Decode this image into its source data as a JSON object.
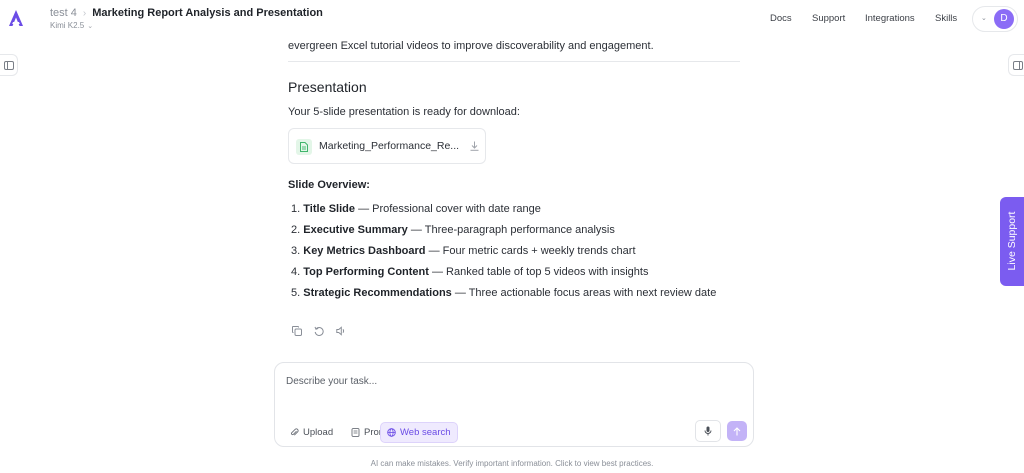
{
  "header": {
    "project": "test 4",
    "separator": "›",
    "title": "Marketing Report Analysis and Presentation",
    "model": "Kimi K2.5",
    "nav": {
      "docs": "Docs",
      "support": "Support",
      "integrations": "Integrations",
      "skills": "Skills"
    },
    "avatar_initial": "D"
  },
  "message": {
    "previous_text": "evergreen Excel tutorial videos to improve discoverability and engagement.",
    "section_title": "Presentation",
    "ready_text": "Your 5-slide presentation is ready for download:",
    "file_name": "Marketing_Performance_Re...",
    "overview_title": "Slide Overview:",
    "slides": [
      {
        "number": "1.",
        "title": "Title Slide",
        "description": " — Professional cover with date range"
      },
      {
        "number": "2.",
        "title": "Executive Summary",
        "description": " — Three-paragraph performance analysis"
      },
      {
        "number": "3.",
        "title": "Key Metrics Dashboard",
        "description": " — Four metric cards + weekly trends chart"
      },
      {
        "number": "4.",
        "title": "Top Performing Content",
        "description": " — Ranked table of top 5 videos with insights"
      },
      {
        "number": "5.",
        "title": "Strategic Recommendations",
        "description": " — Three actionable focus areas with next review date"
      }
    ]
  },
  "composer": {
    "placeholder": "Describe your task...",
    "upload_label": "Upload",
    "prompts_label": "Prompts",
    "web_search_label": "Web search"
  },
  "disclaimer": "AI can make mistakes. Verify important information. Click to view best practices.",
  "live_support": "Live Support",
  "colors": {
    "accent": "#7b5cf0",
    "avatar": "#8b6cf6",
    "file_icon_bg": "#e3f6e8",
    "file_icon": "#3fb56b"
  }
}
